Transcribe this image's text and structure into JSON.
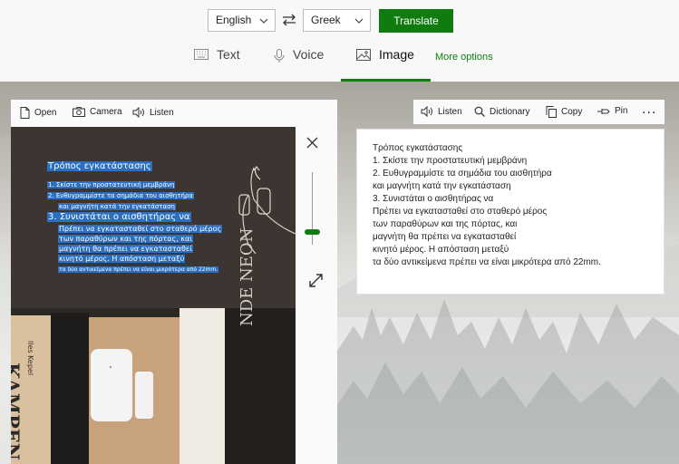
{
  "header": {
    "from_language": "English",
    "to_language": "Greek",
    "translate_label": "Translate",
    "tabs": [
      {
        "label": "Text",
        "icon": "keyboard-icon"
      },
      {
        "label": "Voice",
        "icon": "microphone-icon"
      },
      {
        "label": "Image",
        "icon": "image-icon",
        "selected": true
      }
    ],
    "more_options_label": "More options"
  },
  "colors": {
    "accent": "#107c10",
    "highlight": "#2b6fc2"
  },
  "left_toolbar": {
    "open_label": "Open",
    "camera_label": "Camera",
    "listen_label": "Listen"
  },
  "right_toolbar": {
    "listen_label": "Listen",
    "dictionary_label": "Dictionary",
    "copy_label": "Copy",
    "pin_label": "Pin",
    "more_label": "..."
  },
  "overlay": {
    "lines": [
      "Τρόπος εγκατάστασης",
      "1. Σκίστε την προστατευτική μεμβράνη",
      "2. Ευθυγραμμίστε τα σημάδια του αισθητήρα",
      "και μαγνήτη κατά την εγκατάσταση",
      "3. Συνιστάται ο αισθητήρας να",
      "Πρέπει να εγκατασταθεί στο σταθερό μέρος",
      "των παραθύρων και της πόρτας, και",
      "μαγνήτη θα πρέπει να εγκατασταθεί",
      "κινητό μέρος. Η απόσταση μεταξύ",
      "τα δύο αντικείμενα πρέπει να είναι μικρότερα από 22mm."
    ],
    "book_texts": [
      "KAMPEN",
      "NDE NEON",
      "lles Kepel"
    ]
  },
  "result": {
    "lines": [
      "Τρόπος εγκατάστασης",
      "1. Σκίστε την προστατευτική μεμβράνη",
      "2. Ευθυγραμμίστε τα σημάδια του αισθητήρα",
      "και μαγνήτη κατά την εγκατάσταση",
      "3. Συνιστάται ο αισθητήρας να",
      "Πρέπει να εγκατασταθεί στο σταθερό μέρος",
      "των παραθύρων και της πόρτας, και",
      "μαγνήτη θα πρέπει να εγκατασταθεί",
      "κινητό μέρος. Η απόσταση μεταξύ",
      "τα δύο αντικείμενα πρέπει να είναι μικρότερα από 22mm."
    ]
  }
}
